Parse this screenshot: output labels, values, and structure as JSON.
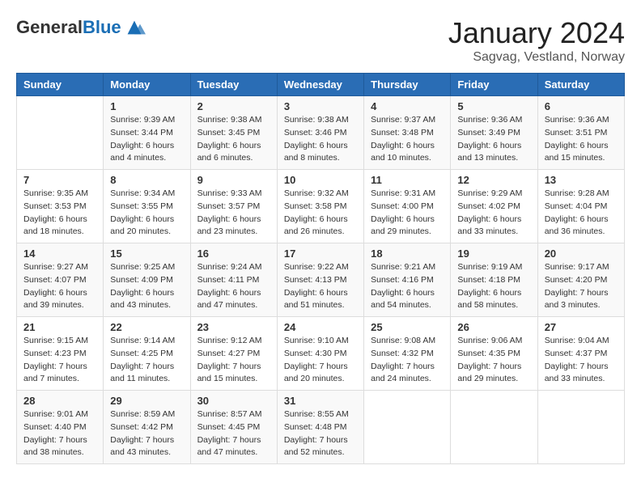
{
  "logo": {
    "general": "General",
    "blue": "Blue"
  },
  "header": {
    "month": "January 2024",
    "location": "Sagvag, Vestland, Norway"
  },
  "weekdays": [
    "Sunday",
    "Monday",
    "Tuesday",
    "Wednesday",
    "Thursday",
    "Friday",
    "Saturday"
  ],
  "weeks": [
    [
      {
        "day": "",
        "info": ""
      },
      {
        "day": "1",
        "info": "Sunrise: 9:39 AM\nSunset: 3:44 PM\nDaylight: 6 hours\nand 4 minutes."
      },
      {
        "day": "2",
        "info": "Sunrise: 9:38 AM\nSunset: 3:45 PM\nDaylight: 6 hours\nand 6 minutes."
      },
      {
        "day": "3",
        "info": "Sunrise: 9:38 AM\nSunset: 3:46 PM\nDaylight: 6 hours\nand 8 minutes."
      },
      {
        "day": "4",
        "info": "Sunrise: 9:37 AM\nSunset: 3:48 PM\nDaylight: 6 hours\nand 10 minutes."
      },
      {
        "day": "5",
        "info": "Sunrise: 9:36 AM\nSunset: 3:49 PM\nDaylight: 6 hours\nand 13 minutes."
      },
      {
        "day": "6",
        "info": "Sunrise: 9:36 AM\nSunset: 3:51 PM\nDaylight: 6 hours\nand 15 minutes."
      }
    ],
    [
      {
        "day": "7",
        "info": "Sunrise: 9:35 AM\nSunset: 3:53 PM\nDaylight: 6 hours\nand 18 minutes."
      },
      {
        "day": "8",
        "info": "Sunrise: 9:34 AM\nSunset: 3:55 PM\nDaylight: 6 hours\nand 20 minutes."
      },
      {
        "day": "9",
        "info": "Sunrise: 9:33 AM\nSunset: 3:57 PM\nDaylight: 6 hours\nand 23 minutes."
      },
      {
        "day": "10",
        "info": "Sunrise: 9:32 AM\nSunset: 3:58 PM\nDaylight: 6 hours\nand 26 minutes."
      },
      {
        "day": "11",
        "info": "Sunrise: 9:31 AM\nSunset: 4:00 PM\nDaylight: 6 hours\nand 29 minutes."
      },
      {
        "day": "12",
        "info": "Sunrise: 9:29 AM\nSunset: 4:02 PM\nDaylight: 6 hours\nand 33 minutes."
      },
      {
        "day": "13",
        "info": "Sunrise: 9:28 AM\nSunset: 4:04 PM\nDaylight: 6 hours\nand 36 minutes."
      }
    ],
    [
      {
        "day": "14",
        "info": "Sunrise: 9:27 AM\nSunset: 4:07 PM\nDaylight: 6 hours\nand 39 minutes."
      },
      {
        "day": "15",
        "info": "Sunrise: 9:25 AM\nSunset: 4:09 PM\nDaylight: 6 hours\nand 43 minutes."
      },
      {
        "day": "16",
        "info": "Sunrise: 9:24 AM\nSunset: 4:11 PM\nDaylight: 6 hours\nand 47 minutes."
      },
      {
        "day": "17",
        "info": "Sunrise: 9:22 AM\nSunset: 4:13 PM\nDaylight: 6 hours\nand 51 minutes."
      },
      {
        "day": "18",
        "info": "Sunrise: 9:21 AM\nSunset: 4:16 PM\nDaylight: 6 hours\nand 54 minutes."
      },
      {
        "day": "19",
        "info": "Sunrise: 9:19 AM\nSunset: 4:18 PM\nDaylight: 6 hours\nand 58 minutes."
      },
      {
        "day": "20",
        "info": "Sunrise: 9:17 AM\nSunset: 4:20 PM\nDaylight: 7 hours\nand 3 minutes."
      }
    ],
    [
      {
        "day": "21",
        "info": "Sunrise: 9:15 AM\nSunset: 4:23 PM\nDaylight: 7 hours\nand 7 minutes."
      },
      {
        "day": "22",
        "info": "Sunrise: 9:14 AM\nSunset: 4:25 PM\nDaylight: 7 hours\nand 11 minutes."
      },
      {
        "day": "23",
        "info": "Sunrise: 9:12 AM\nSunset: 4:27 PM\nDaylight: 7 hours\nand 15 minutes."
      },
      {
        "day": "24",
        "info": "Sunrise: 9:10 AM\nSunset: 4:30 PM\nDaylight: 7 hours\nand 20 minutes."
      },
      {
        "day": "25",
        "info": "Sunrise: 9:08 AM\nSunset: 4:32 PM\nDaylight: 7 hours\nand 24 minutes."
      },
      {
        "day": "26",
        "info": "Sunrise: 9:06 AM\nSunset: 4:35 PM\nDaylight: 7 hours\nand 29 minutes."
      },
      {
        "day": "27",
        "info": "Sunrise: 9:04 AM\nSunset: 4:37 PM\nDaylight: 7 hours\nand 33 minutes."
      }
    ],
    [
      {
        "day": "28",
        "info": "Sunrise: 9:01 AM\nSunset: 4:40 PM\nDaylight: 7 hours\nand 38 minutes."
      },
      {
        "day": "29",
        "info": "Sunrise: 8:59 AM\nSunset: 4:42 PM\nDaylight: 7 hours\nand 43 minutes."
      },
      {
        "day": "30",
        "info": "Sunrise: 8:57 AM\nSunset: 4:45 PM\nDaylight: 7 hours\nand 47 minutes."
      },
      {
        "day": "31",
        "info": "Sunrise: 8:55 AM\nSunset: 4:48 PM\nDaylight: 7 hours\nand 52 minutes."
      },
      {
        "day": "",
        "info": ""
      },
      {
        "day": "",
        "info": ""
      },
      {
        "day": "",
        "info": ""
      }
    ]
  ]
}
